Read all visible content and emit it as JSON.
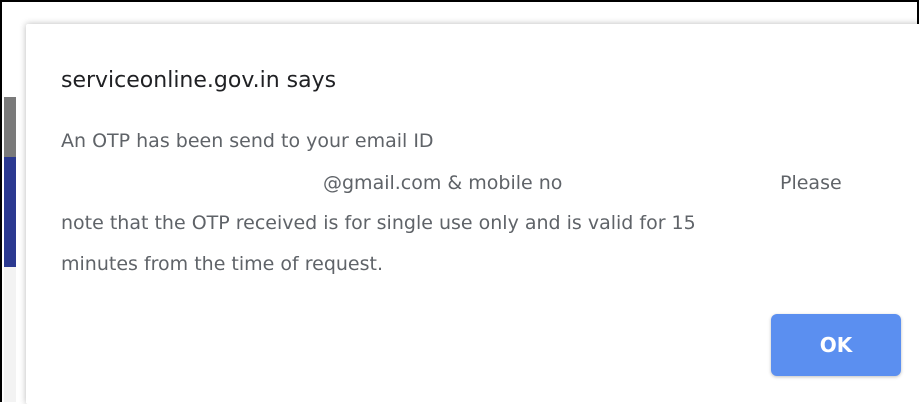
{
  "dialog": {
    "title": "serviceonline.gov.in says",
    "message": {
      "line1": "An OTP has been send to your email ID",
      "line2_email_domain": "@gmail.com & mobile no",
      "line2_tail": "Please",
      "line3": "note that the OTP received is for single use only and is valid for 15",
      "line4": "minutes from the time of request."
    },
    "ok_label": "OK"
  },
  "colors": {
    "ok_button": "#5b8ff0",
    "title_text": "#202124",
    "body_text": "#5f6368",
    "side_navy": "#2b3990",
    "side_gray": "#7a7a7a"
  }
}
